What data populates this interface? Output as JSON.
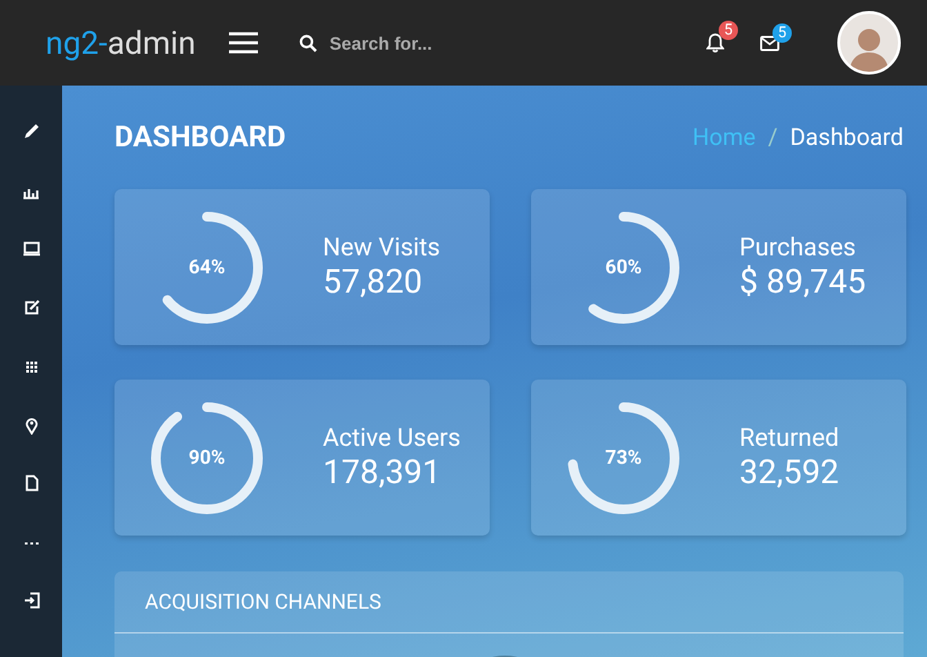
{
  "header": {
    "logo": {
      "accent": "ng2-",
      "rest": "admin"
    },
    "search": {
      "placeholder": "Search for..."
    },
    "notifications": {
      "count": "5",
      "color": "#e85656"
    },
    "messages": {
      "count": "5",
      "color": "#1fa1ea"
    }
  },
  "page": {
    "title": "DASHBOARD",
    "breadcrumb_separator": "/",
    "breadcrumb": [
      {
        "label": "Home",
        "kind": "link"
      },
      {
        "label": "Dashboard",
        "kind": "current"
      }
    ]
  },
  "stats": [
    {
      "label": "New Visits",
      "value": "57,820",
      "percent": "64%",
      "level": 0.64
    },
    {
      "label": "Purchases",
      "value": "$ 89,745",
      "percent": "60%",
      "level": 0.6
    },
    {
      "label": "Active Users",
      "value": "178,391",
      "percent": "90%",
      "level": 0.9
    },
    {
      "label": "Returned",
      "value": "32,592",
      "percent": "73%",
      "level": 0.73
    }
  ],
  "panel": {
    "title": "ACQUISITION CHANNELS"
  }
}
